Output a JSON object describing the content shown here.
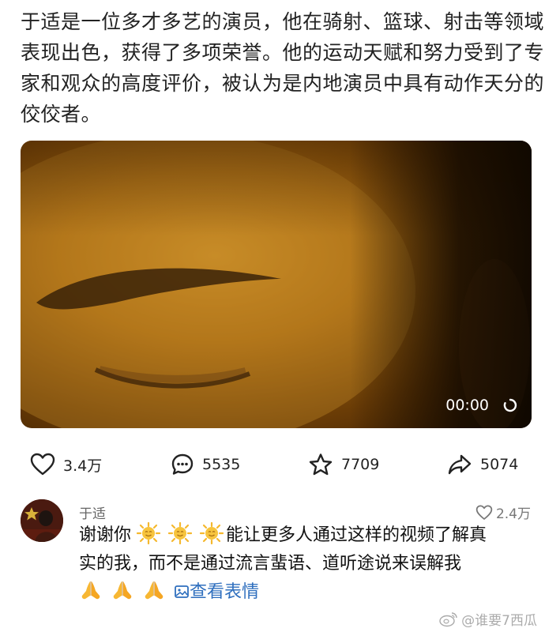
{
  "post": {
    "lines": [
      "于适是一位多才多艺的演员，他在骑射、篮球、射击等领域",
      "表现出色，获得了多项荣誉。他的运动天赋和努力受到了专",
      "家和观众的高度评价，被认为是内地演员中具有动作天分的",
      "佼佼者。"
    ]
  },
  "video": {
    "time": "00:00"
  },
  "actions": {
    "likes": "3.4万",
    "comments": "5535",
    "favorites": "7709",
    "shares": "5074"
  },
  "comment": {
    "author": "于适",
    "likes": "2.4万",
    "text_lead": "谢谢你",
    "text_rest_line1": "能让更多人通过这样的视频了解真",
    "text_line2": "实的我，而不是通过流言蜚语、道听途说来误解我",
    "view_stickers": "查看表情",
    "sun_emoji_count": 3,
    "pray_emoji_count": 3
  },
  "watermark": {
    "text": "@谁要7西瓜"
  },
  "colors": {
    "link": "#2f6fbe",
    "accent_sun": "#f5b82e"
  }
}
